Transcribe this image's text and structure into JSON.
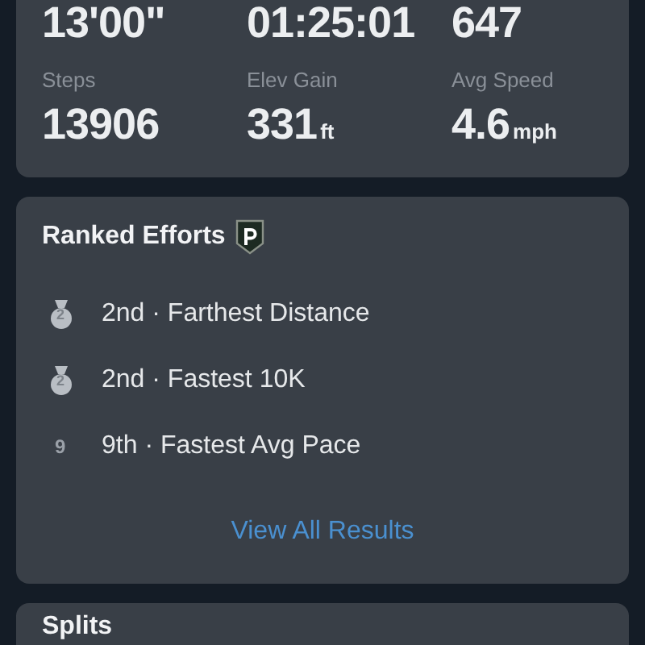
{
  "stats_top": [
    {
      "value": "13'00\""
    },
    {
      "value": "01:25:01"
    },
    {
      "value": "647"
    }
  ],
  "stats": [
    {
      "label": "Steps",
      "value": "13906"
    },
    {
      "label": "Elev Gain",
      "value": "331",
      "unit": "ft"
    },
    {
      "label": "Avg Speed",
      "value": "4.6",
      "unit": "mph"
    }
  ],
  "ranked_efforts": {
    "title": "Ranked Efforts",
    "items": [
      {
        "kind": "medal",
        "rank_number": "2",
        "text": "2nd · Farthest Distance"
      },
      {
        "kind": "medal",
        "rank_number": "2",
        "text": "2nd · Fastest 10K"
      },
      {
        "kind": "plain",
        "rank_number": "9",
        "text": "9th · Fastest Avg Pace"
      }
    ],
    "link": "View All Results"
  },
  "splits": {
    "title": "Splits"
  }
}
